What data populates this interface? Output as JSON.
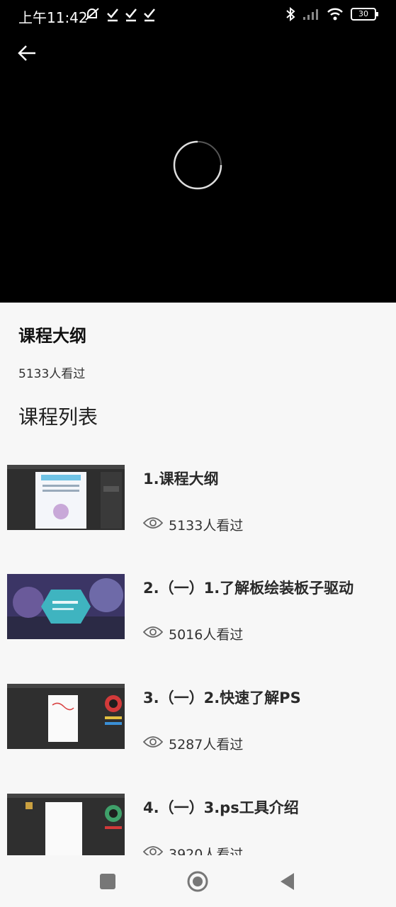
{
  "status_bar": {
    "time": "上午11:42",
    "battery": "30",
    "icons": [
      "mute-bell-icon",
      "check-icon",
      "check-icon",
      "check-icon",
      "bluetooth-icon",
      "signal-icon",
      "wifi-icon",
      "battery-icon"
    ]
  },
  "player": {
    "state": "loading"
  },
  "course": {
    "title": "课程大纲",
    "views": "5133人看过"
  },
  "list": {
    "heading": "课程列表",
    "items": [
      {
        "title": "1.课程大纲",
        "views": "5133人看过"
      },
      {
        "title": "2.（一）1.了解板绘装板子驱动",
        "views": "5016人看过"
      },
      {
        "title": "3.（一）2.快速了解PS",
        "views": "5287人看过"
      },
      {
        "title": "4.（一）3.ps工具介绍",
        "views": "3920人看过"
      }
    ]
  },
  "colors": {
    "background": "#f7f7f7",
    "video_bg": "#000000",
    "text_primary": "#111111"
  }
}
